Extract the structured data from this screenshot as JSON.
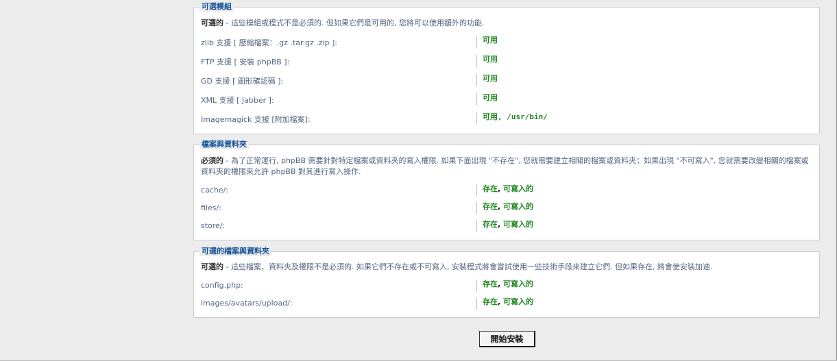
{
  "optional_modules": {
    "legend": "可選模組",
    "intro_strong": "可選的",
    "intro_text": " - 這些模組或程式不是必須的. 但如果它們是可用的, 您將可以使用額外的功能.",
    "rows": [
      {
        "label": "zlib 支援 [ 壓縮檔案：.gz .tar.gz .zip ]:",
        "value": "可用",
        "extra": ""
      },
      {
        "label": "FTP 支援 [ 安裝 phpBB ]:",
        "value": "可用",
        "extra": ""
      },
      {
        "label": "GD 支援 [ 圖形確認碼 ]:",
        "value": "可用",
        "extra": ""
      },
      {
        "label": "XML 支援 [ Jabber ]:",
        "value": "可用",
        "extra": ""
      },
      {
        "label": "Imagemagick 支援 [附加檔案]:",
        "value": "可用",
        "extra": ", /usr/bin/"
      }
    ]
  },
  "files_dirs": {
    "legend": "檔案與資料夾",
    "intro_strong": "必須的",
    "intro_text": " - 為了正常運行, phpBB 需要針對特定檔案或資料夾的寫入權限. 如果下面出現 \"不存在\", 您就需要建立相關的檔案或資料夾；如果出現 \"不可寫入\", 您就需要改變相關的檔案或資料夾的權限來允許 phpBB 對其進行寫入操作.",
    "rows": [
      {
        "label": "cache/:",
        "exists": "存在",
        "writable": "可寫入的"
      },
      {
        "label": "files/:",
        "exists": "存在",
        "writable": "可寫入的"
      },
      {
        "label": "store/:",
        "exists": "存在",
        "writable": "可寫入的"
      }
    ]
  },
  "optional_files": {
    "legend": "可選的檔案與資料夾",
    "intro_strong": "可選的",
    "intro_text": " - 這些檔案、資料夾及權限不是必須的. 如果它們不存在或不可寫入, 安裝程式將會嘗試使用一些技術手段來建立它們. 但如果存在, 將會使安裝加速.",
    "rows": [
      {
        "label": "config.php:",
        "exists": "存在",
        "writable": "可寫入的"
      },
      {
        "label": "images/avatars/upload/:",
        "exists": "存在",
        "writable": "可寫入的"
      }
    ]
  },
  "comma": ", ",
  "install_button": "開始安裝",
  "colors": {
    "ok_green": "#228822",
    "legend_blue": "#115098",
    "label_text": "#536482"
  }
}
